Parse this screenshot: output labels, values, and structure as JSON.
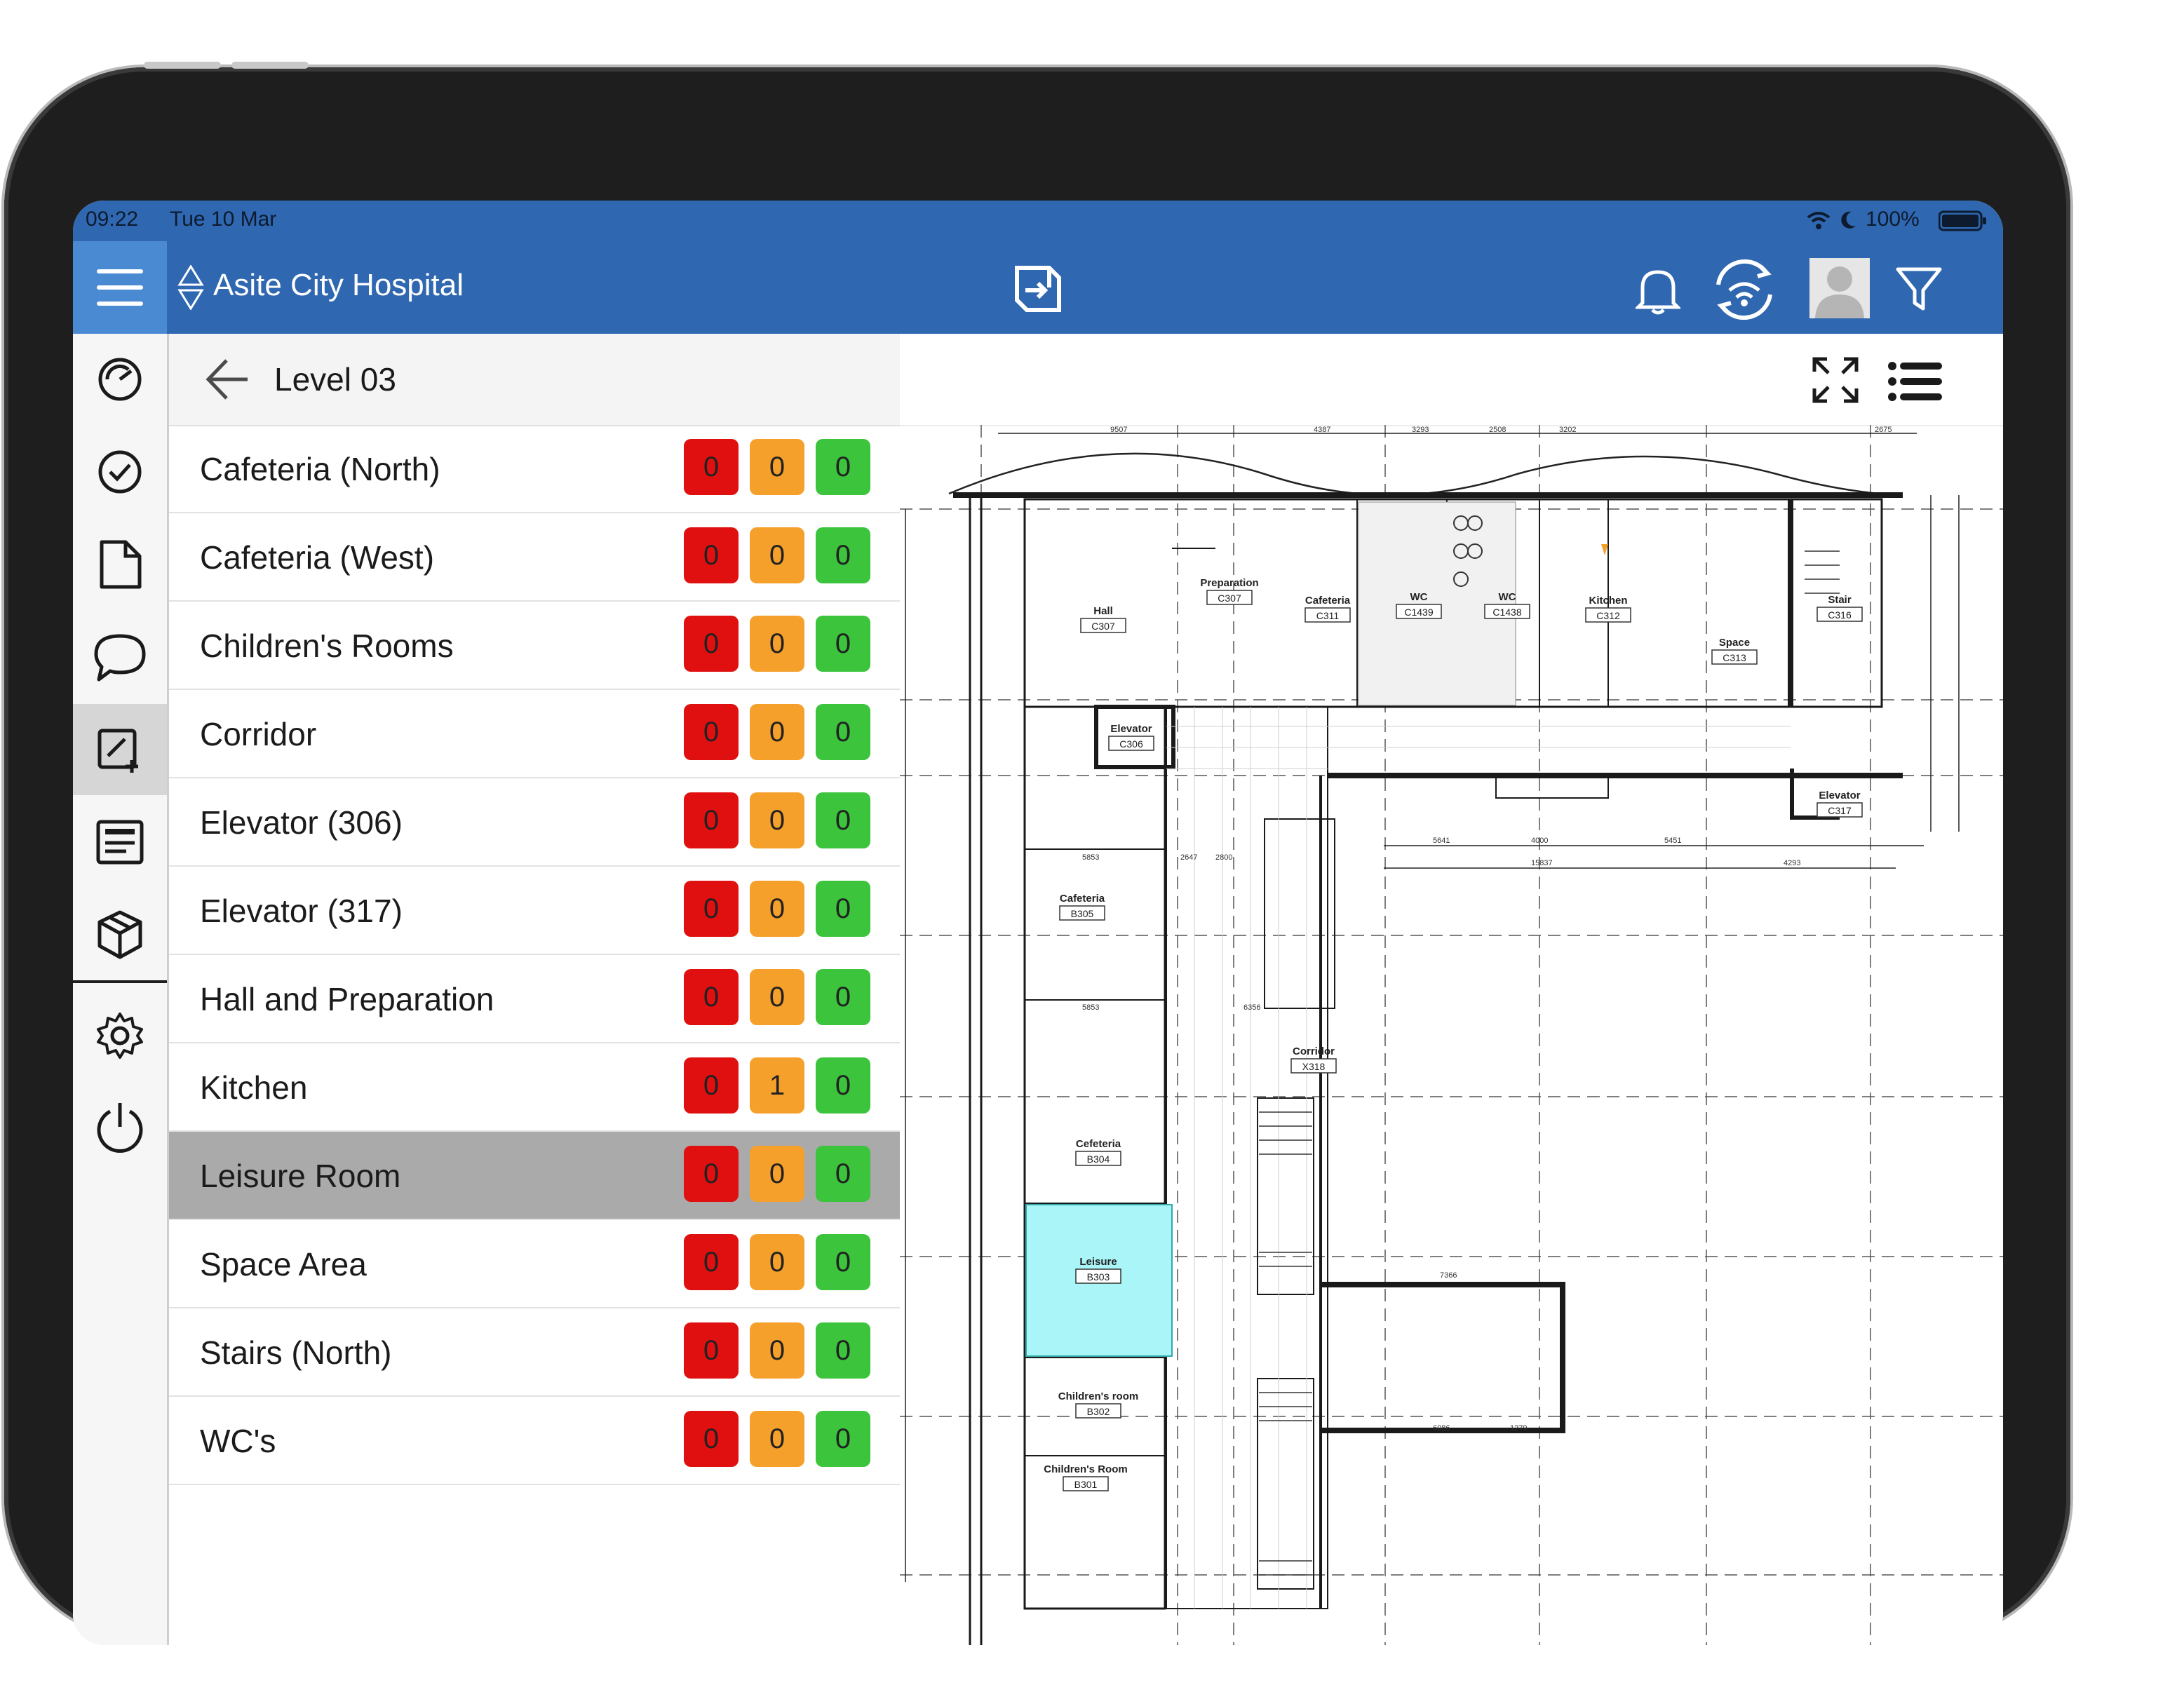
{
  "status_bar": {
    "time": "09:22",
    "date": "Tue 10 Mar",
    "battery": "100%"
  },
  "header": {
    "project_name": "Asite City Hospital"
  },
  "panel": {
    "level_title": "Level 03"
  },
  "rooms": [
    {
      "name": "Cafeteria (North)",
      "red": "0",
      "orange": "0",
      "green": "0"
    },
    {
      "name": "Cafeteria (West)",
      "red": "0",
      "orange": "0",
      "green": "0"
    },
    {
      "name": "Children's Rooms",
      "red": "0",
      "orange": "0",
      "green": "0"
    },
    {
      "name": "Corridor",
      "red": "0",
      "orange": "0",
      "green": "0"
    },
    {
      "name": "Elevator (306)",
      "red": "0",
      "orange": "0",
      "green": "0"
    },
    {
      "name": "Elevator (317)",
      "red": "0",
      "orange": "0",
      "green": "0"
    },
    {
      "name": "Hall and Preparation",
      "red": "0",
      "orange": "0",
      "green": "0"
    },
    {
      "name": "Kitchen",
      "red": "0",
      "orange": "1",
      "green": "0"
    },
    {
      "name": "Leisure Room",
      "red": "0",
      "orange": "0",
      "green": "0",
      "selected": true
    },
    {
      "name": "Space Area",
      "red": "0",
      "orange": "0",
      "green": "0"
    },
    {
      "name": "Stairs (North)",
      "red": "0",
      "orange": "0",
      "green": "0"
    },
    {
      "name": "WC's",
      "red": "0",
      "orange": "0",
      "green": "0"
    }
  ],
  "plan": {
    "rooms": [
      {
        "name": "Hall",
        "code": "C307"
      },
      {
        "name": "Preparation",
        "code": "C307"
      },
      {
        "name": "Cafeteria",
        "code": "C311"
      },
      {
        "name": "WC",
        "code": "C1439"
      },
      {
        "name": "WC",
        "code": "C1438"
      },
      {
        "name": "Kitchen",
        "code": "C312"
      },
      {
        "name": "Space",
        "code": "C313"
      },
      {
        "name": "Stair",
        "code": "C316"
      },
      {
        "name": "Elevator",
        "code": "C306"
      },
      {
        "name": "Elevator",
        "code": "C317"
      },
      {
        "name": "Cafeteria",
        "code": "B305"
      },
      {
        "name": "Corridor",
        "code": "X318"
      },
      {
        "name": "Cefeteria",
        "code": "B304"
      },
      {
        "name": "Leisure",
        "code": "B303"
      },
      {
        "name": "Children's room",
        "code": "B302"
      },
      {
        "name": "Children's Room",
        "code": "B301"
      }
    ],
    "highlight_color": "#aaf5f8"
  },
  "icons": {
    "rail": [
      "dashboard-icon",
      "tasks-icon",
      "document-icon",
      "discussion-icon",
      "markup-icon",
      "forms-icon",
      "model-icon",
      "settings-icon",
      "power-icon"
    ],
    "header": [
      "hamburger-icon",
      "location-switch-icon",
      "app-logo-icon",
      "bell-icon",
      "sync-icon",
      "avatar",
      "filter-icon"
    ],
    "toolbar": [
      "fullscreen-icon",
      "list-view-icon"
    ]
  },
  "colors": {
    "brand": "#2f67b1",
    "menu_active": "#4a8ad2",
    "red": "#e01010",
    "orange": "#f5a02b",
    "green": "#3cc43c"
  }
}
